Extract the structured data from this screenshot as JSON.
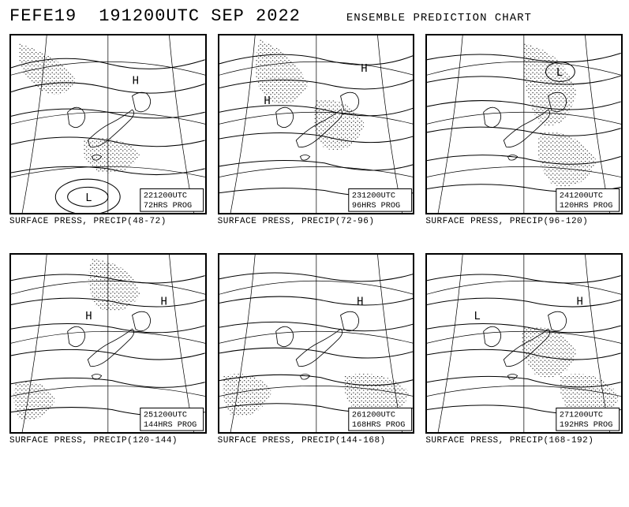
{
  "header": {
    "code": "FEFE19",
    "init_time": "191200UTC SEP 2022",
    "title": "ENSEMBLE PREDICTION CHART"
  },
  "chart_data": [
    {
      "type": "map",
      "valid_time": "221200UTC",
      "prog": "72HRS PROG",
      "caption": "SURFACE PRESS, PRECIP(48-72)",
      "lon_range": [
        110,
        160
      ],
      "lat_range": [
        20,
        55
      ],
      "precip_shaded": true
    },
    {
      "type": "map",
      "valid_time": "231200UTC",
      "prog": "96HRS PROG",
      "caption": "SURFACE PRESS, PRECIP(72-96)",
      "lon_range": [
        110,
        160
      ],
      "lat_range": [
        20,
        55
      ],
      "precip_shaded": true
    },
    {
      "type": "map",
      "valid_time": "241200UTC",
      "prog": "120HRS PROG",
      "caption": "SURFACE PRESS, PRECIP(96-120)",
      "lon_range": [
        110,
        160
      ],
      "lat_range": [
        20,
        55
      ],
      "precip_shaded": true
    },
    {
      "type": "map",
      "valid_time": "251200UTC",
      "prog": "144HRS PROG",
      "caption": "SURFACE PRESS, PRECIP(120-144)",
      "lon_range": [
        110,
        160
      ],
      "lat_range": [
        20,
        55
      ],
      "precip_shaded": true
    },
    {
      "type": "map",
      "valid_time": "261200UTC",
      "prog": "168HRS PROG",
      "caption": "SURFACE PRESS, PRECIP(144-168)",
      "lon_range": [
        110,
        160
      ],
      "lat_range": [
        20,
        55
      ],
      "precip_shaded": true
    },
    {
      "type": "map",
      "valid_time": "271200UTC",
      "prog": "192HRS PROG",
      "caption": "SURFACE PRESS, PRECIP(168-192)",
      "lon_range": [
        110,
        160
      ],
      "lat_range": [
        20,
        55
      ],
      "precip_shaded": true
    }
  ]
}
